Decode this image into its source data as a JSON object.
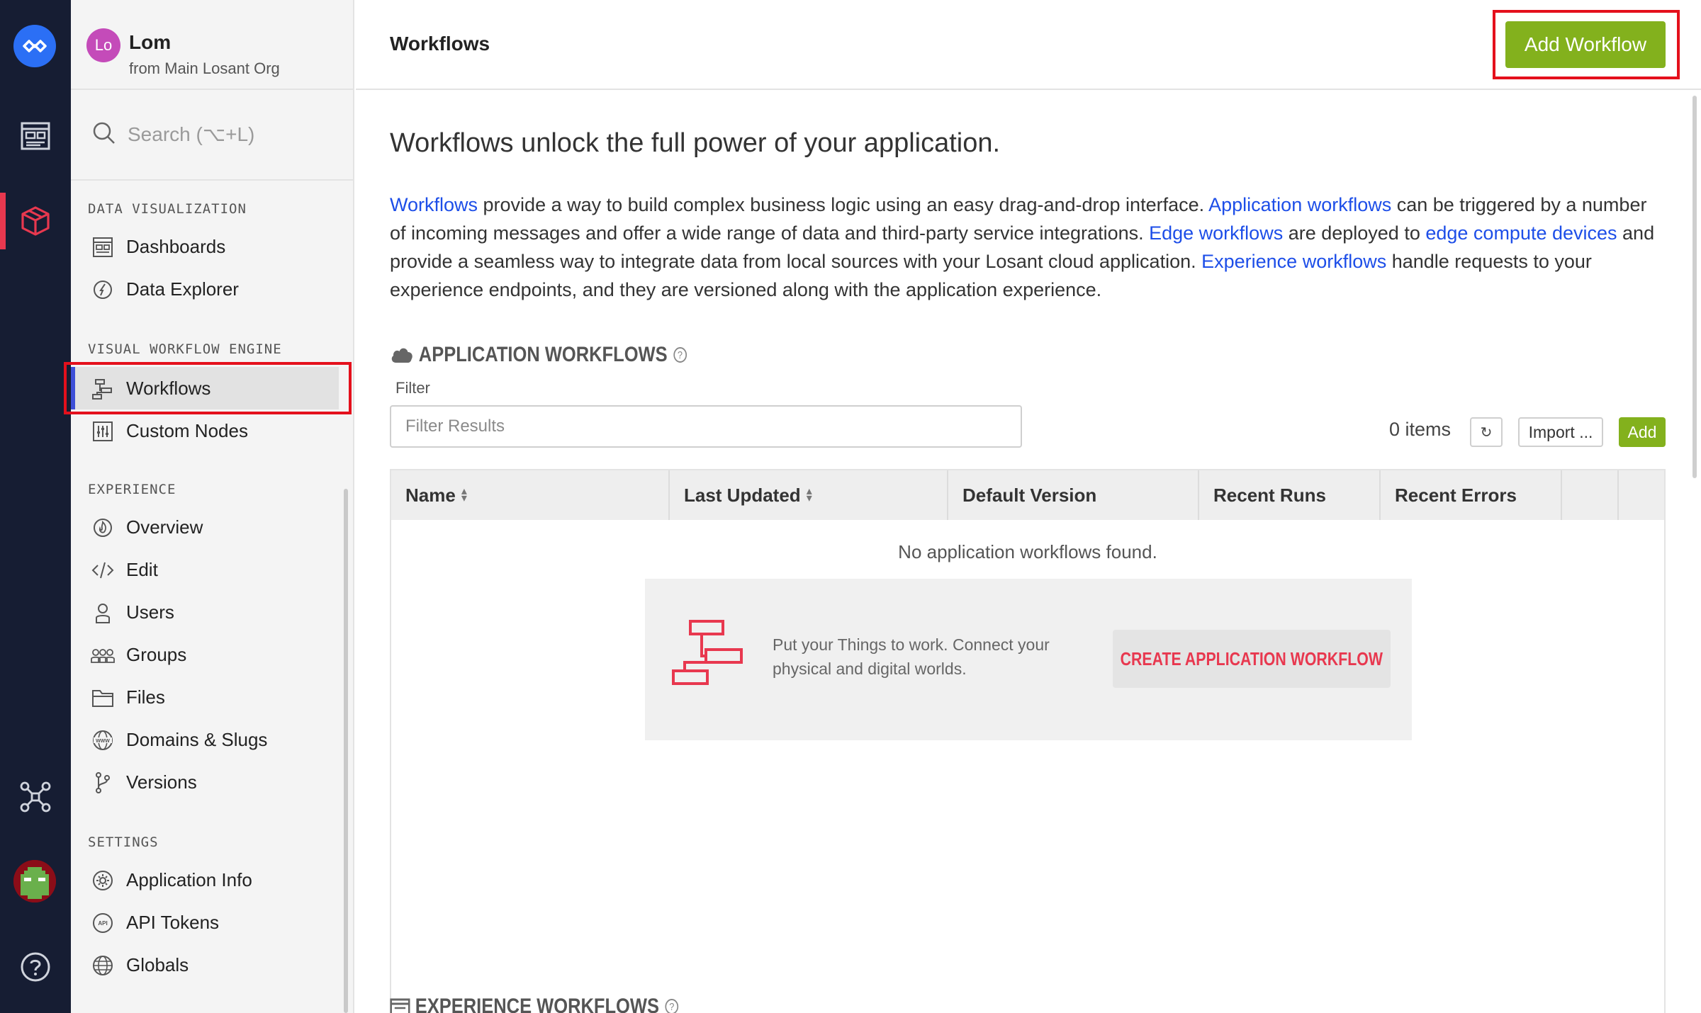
{
  "rail": {
    "items": [
      "logo",
      "dashboards",
      "applications",
      "edge-compute",
      "profile",
      "help"
    ]
  },
  "user": {
    "initials": "Lo",
    "name": "Lom",
    "org": "from Main Losant Org"
  },
  "search": {
    "placeholder": "Search (⌥+L)"
  },
  "sidebar": {
    "sections": [
      {
        "title": "DATA VISUALIZATION",
        "items": [
          {
            "label": "Dashboards",
            "icon": "dashboard-icon"
          },
          {
            "label": "Data Explorer",
            "icon": "compass-icon"
          }
        ]
      },
      {
        "title": "VISUAL WORKFLOW ENGINE",
        "items": [
          {
            "label": "Workflows",
            "icon": "workflow-icon",
            "active": true
          },
          {
            "label": "Custom Nodes",
            "icon": "sliders-icon"
          }
        ]
      },
      {
        "title": "EXPERIENCE",
        "items": [
          {
            "label": "Overview",
            "icon": "flame-icon"
          },
          {
            "label": "Edit",
            "icon": "code-icon"
          },
          {
            "label": "Users",
            "icon": "user-icon"
          },
          {
            "label": "Groups",
            "icon": "group-icon"
          },
          {
            "label": "Files",
            "icon": "folder-icon"
          },
          {
            "label": "Domains & Slugs",
            "icon": "globe-www-icon"
          },
          {
            "label": "Versions",
            "icon": "branch-icon"
          }
        ]
      },
      {
        "title": "SETTINGS",
        "items": [
          {
            "label": "Application Info",
            "icon": "gear-icon"
          },
          {
            "label": "API Tokens",
            "icon": "api-icon"
          },
          {
            "label": "Globals",
            "icon": "globe-icon"
          }
        ]
      }
    ]
  },
  "header": {
    "title": "Workflows",
    "add_button": "Add Workflow"
  },
  "intro": {
    "title": "Workflows unlock the full power of your application.",
    "p1_link": "Workflows",
    "p1_text": " provide a way to build complex business logic using an easy drag-and-drop interface. ",
    "p2_link": "Application workflows",
    "p2_text": " can be triggered by a number of incoming messages and offer a wide range of data and third-party service integrations. ",
    "p3_link": "Edge workflows",
    "p3_text": " are deployed to ",
    "p4_link": "edge compute devices",
    "p4_text": " and provide a seamless way to integrate data from local sources with your Losant cloud application. ",
    "p5_link": "Experience workflows",
    "p5_text": " handle requests to your experience endpoints, and they are versioned along with the application experience."
  },
  "app_workflows": {
    "heading": "APPLICATION WORKFLOWS",
    "help": "?",
    "filter_label": "Filter",
    "filter_placeholder": "Filter Results",
    "count": "0 items",
    "refresh": "↻",
    "import": "Import ...",
    "add": "Add",
    "columns": [
      "Name",
      "Last Updated",
      "Default Version",
      "Recent Runs",
      "Recent Errors"
    ],
    "empty_text": "No application workflows found.",
    "cta_text": "Put your Things to work. Connect your physical and digital worlds.",
    "cta_button": "CREATE APPLICATION WORKFLOW"
  },
  "experience_workflows": {
    "heading": "EXPERIENCE WORKFLOWS",
    "help": "?"
  },
  "colors": {
    "rail_bg": "#161d33",
    "accent_red": "#e8384f",
    "add_green": "#83b11d",
    "link_blue": "#1d4ee8",
    "highlight": "#e4101c"
  }
}
